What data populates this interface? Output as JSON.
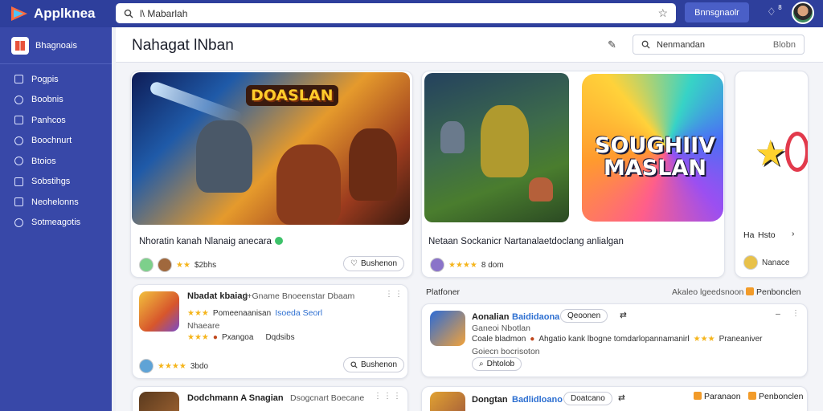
{
  "app": {
    "name": "Applknea"
  },
  "search": {
    "value": "l\\ Mabarlah"
  },
  "top_button": "Bnnsgnaolr",
  "notification_badge": "8",
  "sidebar": {
    "header": "Bhagnoais",
    "items": [
      {
        "label": "Pogpis"
      },
      {
        "label": "Boobnis"
      },
      {
        "label": "Panhcos"
      },
      {
        "label": "Boochnurt"
      },
      {
        "label": "Btoios"
      },
      {
        "label": "Sobstihgs"
      },
      {
        "label": "Neohelonns"
      },
      {
        "label": "Sotmeagotis"
      }
    ]
  },
  "page": {
    "title": "Nahagat lNban",
    "search_placeholder": "Nenmandan",
    "search_right": "Blobn"
  },
  "featured": [
    {
      "logo_text": "DOASLAN",
      "caption": "Nhoratin kanah Nlanaig anecara",
      "rating_text": "$2bhs",
      "action": "Bushenon"
    },
    {
      "logo_text": "SOUGHIIV MASLAN",
      "caption": "Netaan Sockanicr Nartanalaetdoclang anlialgan",
      "rating_text": "8 dom"
    },
    {
      "caption_left": "Ha",
      "caption_right": "Hsto",
      "meta": "Nanace"
    }
  ],
  "list_left": [
    {
      "title": "Nbadat kbaiag",
      "subtitle": "l+Gname Bnoeenstar Dbaam",
      "line2_a": "Pomeenaanisan",
      "line2_b": "Isoeda Seorl",
      "line3": "Nhaeare",
      "line4_a": "Pxangoa",
      "line4_b": "Dqdsibs",
      "rating_text": "3bdo",
      "action": "Bushenon"
    },
    {
      "title": "Dodchmann A Snagian",
      "subtitle": "Dsogcnart Boecane"
    }
  ],
  "right_section": {
    "label": "Platfoner",
    "link1": "Akaleo lgeedsnoon",
    "link2": "Penbonclen"
  },
  "list_right": [
    {
      "title": "Aonalian",
      "title_blue": "Baididaona",
      "pill": "Qeoonen",
      "line2": "Ganeoi Nbotlan",
      "line3": "Coale bladmon",
      "line3_b": "Ahgatio kank lbogne tomdarlopannamanirl",
      "line3_c": "Praneaniver",
      "line4": "Goiecn bocrisoton",
      "action": "Dhtolob"
    },
    {
      "title": "Dongtan",
      "title_blue": "Badlidloano",
      "pill": "Doatcano",
      "tag1": "Paranaon",
      "tag2": "Penbonclen"
    }
  ],
  "colors": {
    "topbar": "#2e3f9c",
    "sidebar": "#3848a8",
    "accent": "#2d6fd1",
    "star": "#f5b51c"
  }
}
